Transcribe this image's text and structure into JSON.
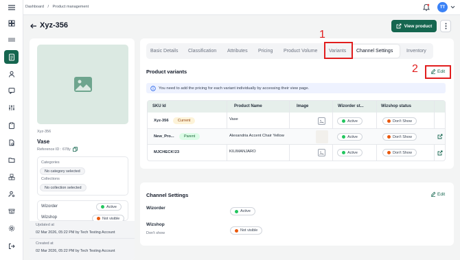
{
  "breadcrumb": {
    "home": "Dashboard",
    "separator": "/",
    "current": "Product management"
  },
  "user": {
    "initials": "TT"
  },
  "page": {
    "title": "Xyz-356",
    "view_button": "View product"
  },
  "left_panel": {
    "sku": "Xyz-356",
    "name": "Vase",
    "reference": "Reference ID : 678y",
    "categories_label": "Categories",
    "categories_value": "No category selected",
    "collections_label": "Collections",
    "collections_value": "No collection selected",
    "wizorder_label": "Wizorder",
    "wizorder_status": "Active",
    "wizshop_label": "Wizshop",
    "wizshop_status": "Not visible",
    "updated_label": "Updated at",
    "updated_value": "02 Mar 2026, 05:22 PM by Tech Testing Account",
    "created_label": "Created at",
    "created_value": "02 Mar 2026, 05:22 PM by Tech Testing Account"
  },
  "tabs": [
    "Basic Details",
    "Classification",
    "Attributes",
    "Pricing",
    "Product Volume",
    "Variants",
    "Channel Settings",
    "Inventory"
  ],
  "variants": {
    "title": "Product variants",
    "edit_label": "Edit",
    "info": "You need to add the pricing for each variant individually by accessing their view page.",
    "columns": [
      "SKU Id",
      "Product Name",
      "Image",
      "Wizorder st...",
      "Wizshop status"
    ],
    "rows": [
      {
        "sku": "Xyz-356",
        "badge": "Current",
        "name": "Vase",
        "wizorder": "Active",
        "wizshop": "Don't Show"
      },
      {
        "sku": "New_Pro...",
        "badge": "Parent",
        "name": "Alexandria Accent Chair Yellow",
        "wizorder": "Active",
        "wizshop": "Don't Show"
      },
      {
        "sku": "MJCHECK!23",
        "badge": "",
        "name": "KILIMANJARO",
        "wizorder": "Active",
        "wizshop": "Don't Show"
      }
    ]
  },
  "channel_settings": {
    "title": "Channel Settings",
    "edit_label": "Edit",
    "wizorder_label": "Wizorder",
    "wizorder_status": "Active",
    "wizshop_label": "Wizshop",
    "wizshop_sub": "Don't show",
    "wizshop_status": "Not visible"
  },
  "annotations": {
    "one": "1",
    "two": "2"
  },
  "colors": {
    "brand": "#15664f",
    "active": "#22c55e",
    "inactive": "#ea580c",
    "annotation": "#e11d1d"
  }
}
